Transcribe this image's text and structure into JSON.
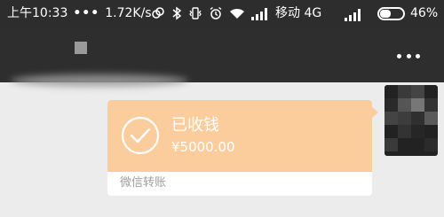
{
  "status_bar": {
    "time": "上午10:33",
    "dots": "•••",
    "net_speed": "1.72K/s",
    "carrier": "移动 4G",
    "battery_pct": "46%",
    "icons": [
      "link-icon",
      "bluetooth-icon",
      "vibrate-icon",
      "alarm-icon",
      "wifi-icon",
      "signal-icon",
      "signal-icon",
      "battery-icon"
    ]
  },
  "nav": {
    "more_icon": "more-dots-icon"
  },
  "transfer_card": {
    "title": "已收钱",
    "amount": "¥5000.00",
    "footer": "微信转账",
    "icon": "check-circle-icon",
    "accent_color": "#fbcd9c"
  }
}
